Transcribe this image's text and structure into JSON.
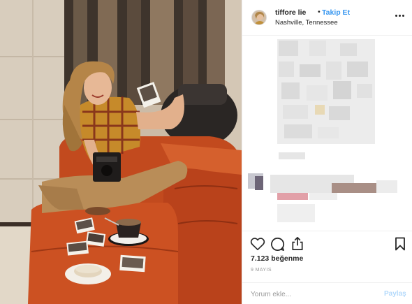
{
  "post": {
    "image_alt": "Woman in plaid shirt sitting on orange leather sofa with instant photos"
  },
  "header": {
    "username": "tiffore lie",
    "separator": "•",
    "follow_label": "Takip Et",
    "location": "Nashville, Tennessee"
  },
  "actions": {
    "like_icon": "heart-icon",
    "comment_icon": "speech-bubble-icon",
    "share_icon": "share-icon",
    "save_icon": "bookmark-icon",
    "likes_text": "7.123 beğenme",
    "date_text": "9 MAYIS"
  },
  "comment_form": {
    "placeholder": "Yorum ekle...",
    "post_label": "Paylaş"
  },
  "colors": {
    "accent": "#3897f0",
    "post_disabled": "#b3d9fb",
    "muted": "#999999",
    "border": "#efefef"
  }
}
